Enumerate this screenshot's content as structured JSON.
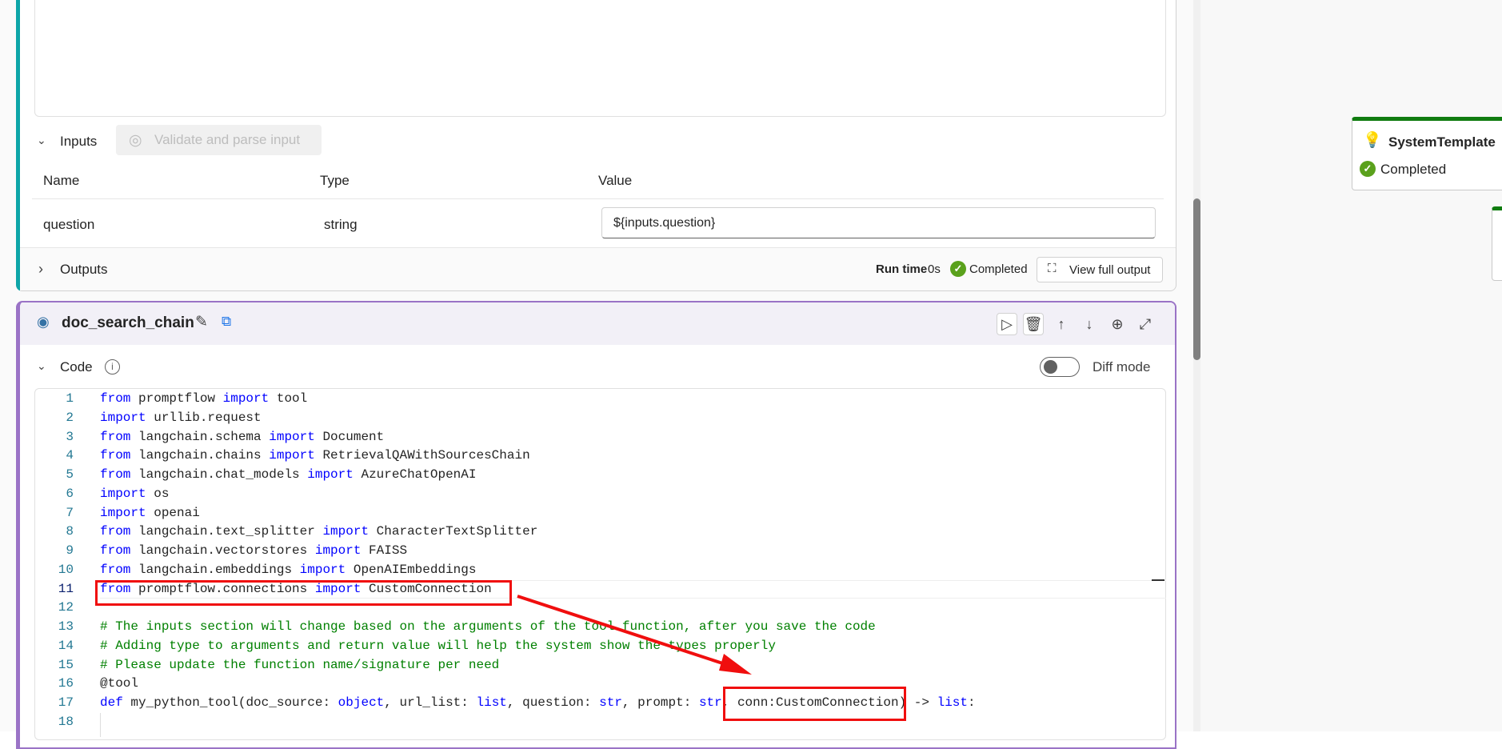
{
  "inputs_section": {
    "label": "Inputs",
    "validate_button": "Validate and parse input",
    "columns": [
      "Name",
      "Type",
      "Value"
    ],
    "rows": [
      {
        "name": "question",
        "type": "string",
        "value": "${inputs.question}"
      }
    ]
  },
  "outputs_section": {
    "label": "Outputs",
    "run_time_label": "Run time",
    "run_time_value": "0s",
    "status": "Completed",
    "view_full_output": "View full output"
  },
  "node": {
    "title": "doc_search_chain",
    "code_label": "Code",
    "diff_mode_label": "Diff mode",
    "diff_mode_on": false
  },
  "code_lines": [
    [
      [
        "k",
        "from"
      ],
      [
        "t",
        " promptflow "
      ],
      [
        "k",
        "import"
      ],
      [
        "t",
        " tool"
      ]
    ],
    [
      [
        "k",
        "import"
      ],
      [
        "t",
        " urllib.request"
      ]
    ],
    [
      [
        "k",
        "from"
      ],
      [
        "t",
        " langchain.schema "
      ],
      [
        "k",
        "import"
      ],
      [
        "t",
        " Document"
      ]
    ],
    [
      [
        "k",
        "from"
      ],
      [
        "t",
        " langchain.chains "
      ],
      [
        "k",
        "import"
      ],
      [
        "t",
        " RetrievalQAWithSourcesChain"
      ]
    ],
    [
      [
        "k",
        "from"
      ],
      [
        "t",
        " langchain.chat_models "
      ],
      [
        "k",
        "import"
      ],
      [
        "t",
        " AzureChatOpenAI"
      ]
    ],
    [
      [
        "k",
        "import"
      ],
      [
        "t",
        " os"
      ]
    ],
    [
      [
        "k",
        "import"
      ],
      [
        "t",
        " openai"
      ]
    ],
    [
      [
        "k",
        "from"
      ],
      [
        "t",
        " langchain.text_splitter "
      ],
      [
        "k",
        "import"
      ],
      [
        "t",
        " CharacterTextSplitter"
      ]
    ],
    [
      [
        "k",
        "from"
      ],
      [
        "t",
        " langchain.vectorstores "
      ],
      [
        "k",
        "import"
      ],
      [
        "t",
        " FAISS"
      ]
    ],
    [
      [
        "k",
        "from"
      ],
      [
        "t",
        " langchain.embeddings "
      ],
      [
        "k",
        "import"
      ],
      [
        "t",
        " OpenAIEmbeddings"
      ]
    ],
    [
      [
        "k",
        "from"
      ],
      [
        "t",
        " promptflow.connections "
      ],
      [
        "k",
        "import"
      ],
      [
        "t",
        " CustomConnection"
      ]
    ],
    [],
    [
      [
        "c",
        "# The inputs section will change based on the arguments of the tool function, after you save the code"
      ]
    ],
    [
      [
        "c",
        "# Adding type to arguments and return value will help the system show the types properly"
      ]
    ],
    [
      [
        "c",
        "# Please update the function name/signature per need"
      ]
    ],
    [
      [
        "t",
        "@tool"
      ]
    ],
    [
      [
        "k",
        "def"
      ],
      [
        "t",
        " my_python_tool(doc_source: "
      ],
      [
        "k",
        "object"
      ],
      [
        "t",
        ", url_list: "
      ],
      [
        "k",
        "list"
      ],
      [
        "t",
        ", question: "
      ],
      [
        "k",
        "str"
      ],
      [
        "t",
        ", prompt: "
      ],
      [
        "k",
        "str"
      ],
      [
        "t",
        ", conn:CustomConnection) -> "
      ],
      [
        "k",
        "list"
      ],
      [
        "t",
        ":"
      ]
    ],
    []
  ],
  "graph": {
    "nodes": [
      {
        "title": "SystemTemplate",
        "status": "Completed"
      }
    ]
  }
}
